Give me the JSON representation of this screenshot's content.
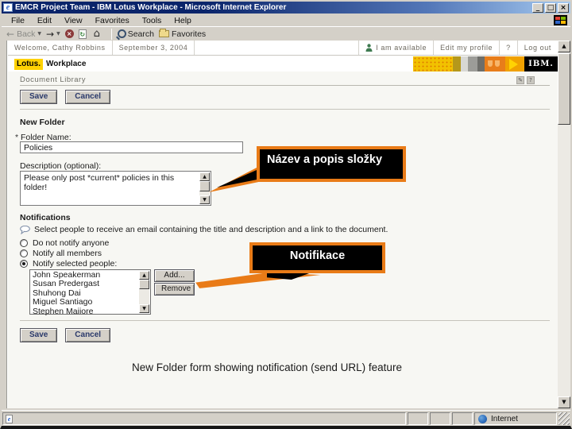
{
  "browser": {
    "title": "EMCR Project Team - IBM Lotus Workplace - Microsoft Internet Explorer",
    "menu": [
      "File",
      "Edit",
      "View",
      "Favorites",
      "Tools",
      "Help"
    ],
    "toolbar": {
      "back": "Back",
      "search": "Search",
      "favorites": "Favorites"
    },
    "statusbar": {
      "zone": "Internet"
    }
  },
  "banner": {
    "welcome": "Welcome, Cathy Robbins",
    "date": "September 3, 2004",
    "availability": "I am available",
    "edit_profile": "Edit my profile",
    "help": "?",
    "logout": "Log out",
    "lotus": "Lotus.",
    "workplace": "Workplace",
    "ibm": "IBM."
  },
  "form": {
    "section_title": "Document Library",
    "save": "Save",
    "cancel": "Cancel",
    "title": "New Folder",
    "required_mark": "*",
    "folder_name_label": "Folder Name:",
    "folder_name_value": "Policies",
    "description_label": "Description (optional):",
    "description_value": "Please only post *current* policies in this folder!",
    "notifications_title": "Notifications",
    "notifications_hint": "Select people to receive an email containing the title and description and a link to the document.",
    "options": [
      {
        "label": "Do not notify anyone",
        "selected": false
      },
      {
        "label": "Notify all members",
        "selected": false
      },
      {
        "label": "Notify selected people:",
        "selected": true
      }
    ],
    "people": [
      "John Speakerman",
      "Susan Predergast",
      "Shuhong Dai",
      "Miguel Santiago",
      "Stephen Maiiore"
    ],
    "add": "Add...",
    "remove": "Remove"
  },
  "callouts": {
    "folder": "Název a popis složky",
    "notifications": "Notifikace"
  },
  "caption": "New Folder form showing notification (send URL) feature",
  "colors": {
    "callout_border": "#E97B17",
    "callout_bg": "#000000",
    "titlebar_left": "#0A246A",
    "titlebar_right": "#A6CAF0",
    "chrome": "#D4D0C8",
    "lotus_yellow": "#FFD203"
  }
}
